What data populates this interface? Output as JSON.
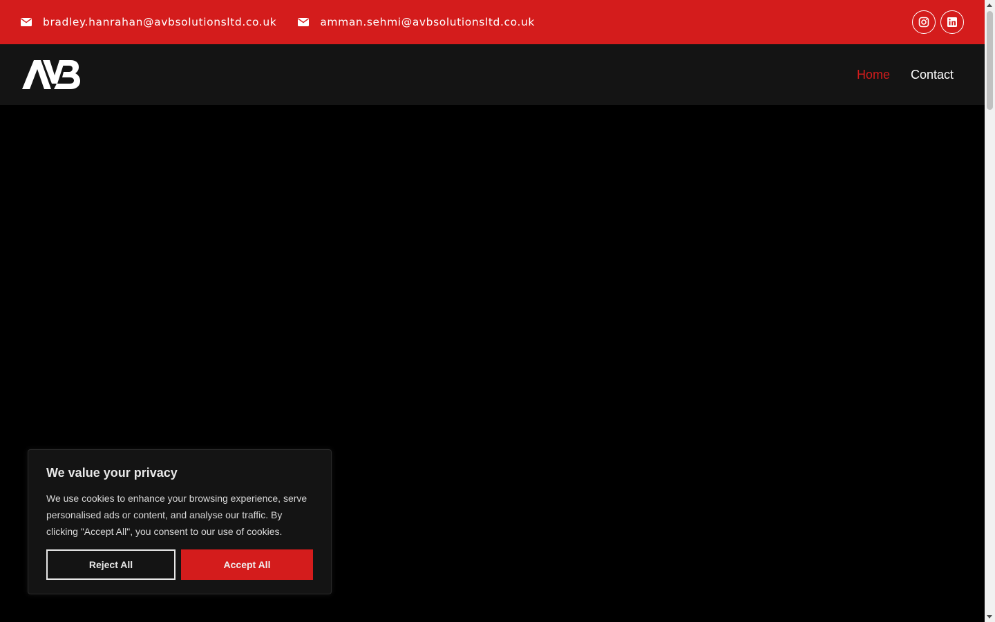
{
  "topbar": {
    "emails": [
      {
        "icon": "envelope-icon",
        "address": "bradley.hanrahan@avbsolutionsltd.co.uk"
      },
      {
        "icon": "envelope-icon",
        "address": "amman.sehmi@avbsolutionsltd.co.uk"
      }
    ],
    "social": [
      {
        "icon": "instagram-icon"
      },
      {
        "icon": "linkedin-icon"
      }
    ]
  },
  "navbar": {
    "logo_text": "AVB",
    "links": [
      {
        "label": "Home",
        "active": true
      },
      {
        "label": "Contact",
        "active": false
      }
    ]
  },
  "cookie_banner": {
    "title": "We value your privacy",
    "body": "We use cookies to enhance your browsing experience, serve personalised ads or content, and analyse our traffic. By clicking \"Accept All\", you consent to our use of cookies.",
    "reject_label": "Reject All",
    "accept_label": "Accept All"
  },
  "colors": {
    "brand_red": "#d41c1c",
    "nav_background": "#141414",
    "page_background": "#000000"
  }
}
